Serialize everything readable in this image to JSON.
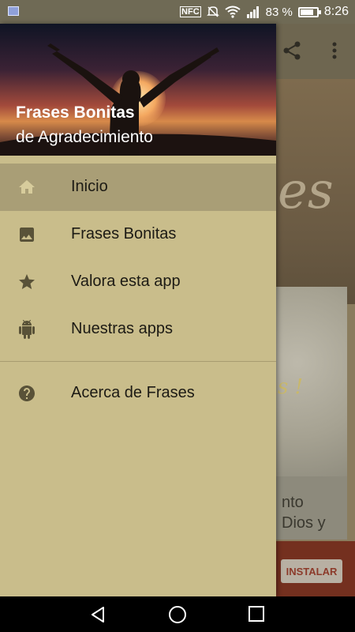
{
  "status_bar": {
    "nfc_label": "NFC",
    "battery_percent": "83 %",
    "battery_level": 83,
    "time": "8:26"
  },
  "app_bg": {
    "banner_partial_text": "es",
    "card_partial_text": "s !",
    "card_title_line1": "nto",
    "card_title_line2": "Dios y",
    "install_label": "INSTALAR"
  },
  "drawer": {
    "header": {
      "title": "Frases Bonitas",
      "subtitle": "de Agradecimiento"
    },
    "items": [
      {
        "label": "Inicio",
        "icon": "home-icon",
        "active": true
      },
      {
        "label": "Frases Bonitas",
        "icon": "image-icon",
        "active": false
      },
      {
        "label": "Valora esta app",
        "icon": "star-icon",
        "active": false
      },
      {
        "label": "Nuestras apps",
        "icon": "android-icon",
        "active": false
      }
    ],
    "secondary_items": [
      {
        "label": "Acerca de Frases",
        "icon": "help-icon"
      }
    ]
  },
  "colors": {
    "drawer_bg": "#c9bd8b",
    "active_item_bg": "#a99e76",
    "icon_color": "#595238",
    "active_icon_color": "#d7cc9c"
  }
}
